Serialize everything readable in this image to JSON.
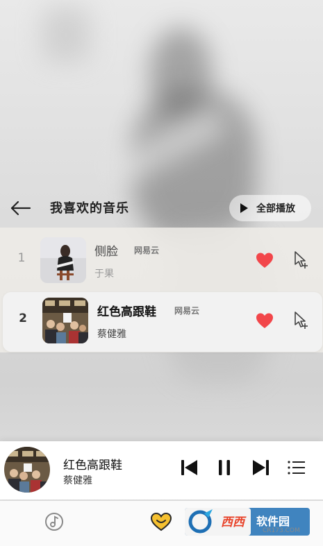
{
  "header": {
    "title": "我喜欢的音乐",
    "play_all_label": "全部播放"
  },
  "songs": [
    {
      "index": "1",
      "title": "侧脸",
      "source": "网易云",
      "artist": "于果",
      "liked": true
    },
    {
      "index": "2",
      "title": "红色高跟鞋",
      "source": "网易云",
      "artist": "蔡健雅",
      "liked": true
    }
  ],
  "now_playing": {
    "title": "红色高跟鞋",
    "artist": "蔡健雅",
    "state": "playing"
  },
  "icons": {
    "back": "arrow-left-icon",
    "play_all": "play-icon",
    "like": "heart-icon",
    "add_to_queue": "add-to-playlist-icon",
    "previous": "skip-previous-icon",
    "pause": "pause-icon",
    "next": "skip-next-icon",
    "playlist": "playlist-icon",
    "tab_music": "music-note-icon",
    "tab_favorites": "heart-face-icon"
  },
  "colors": {
    "heart": "#f2464a",
    "accent_tab": "#f0b400"
  },
  "watermark": {
    "brand_left": "西西",
    "brand_right": "软件园",
    "domain": "CR173.COM"
  }
}
